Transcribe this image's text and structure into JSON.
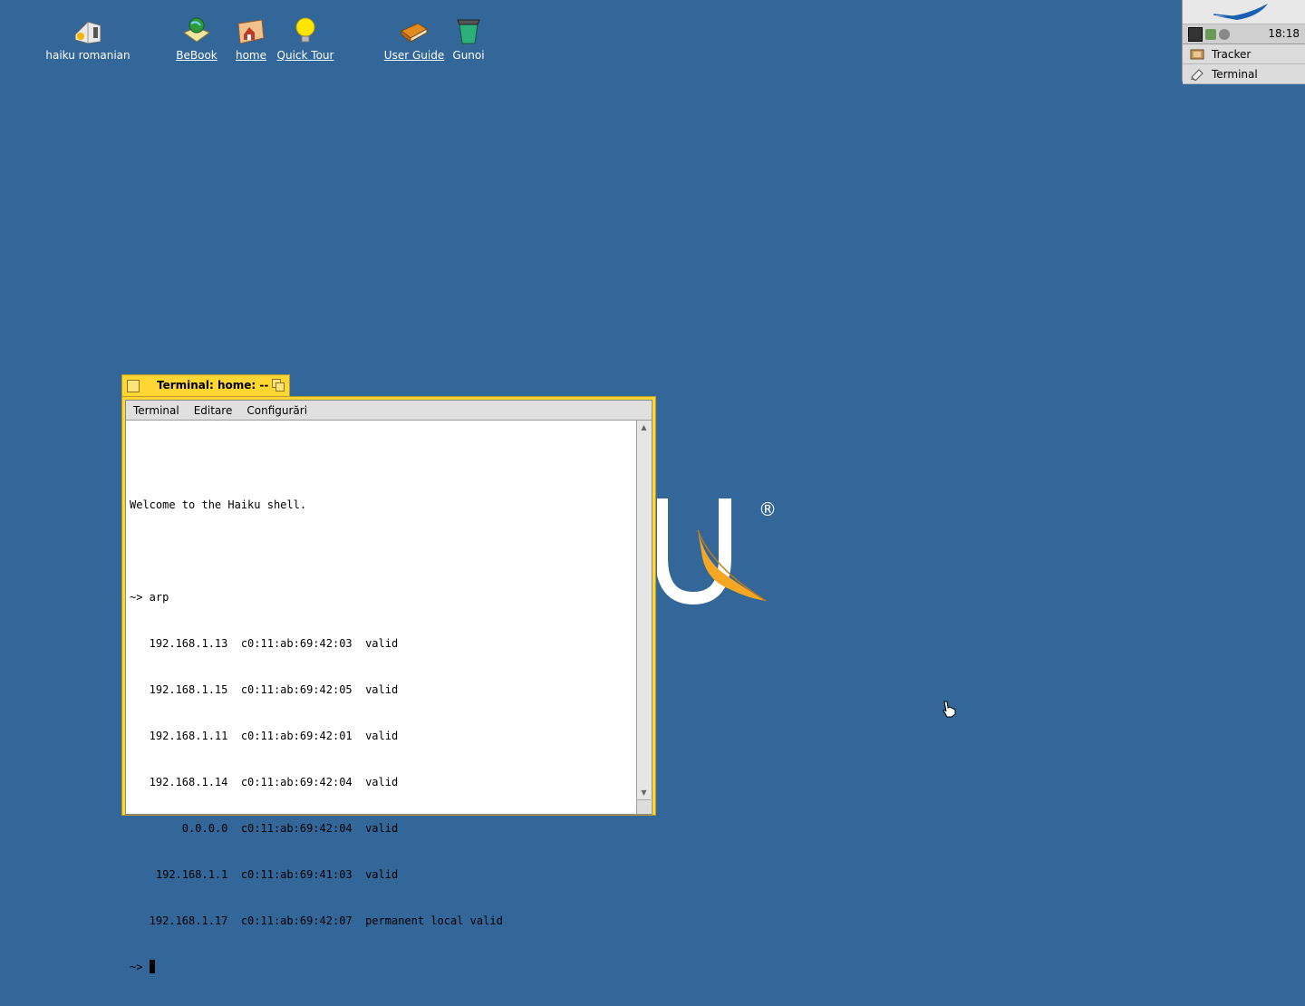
{
  "colors": {
    "desktop": "#336699",
    "window_tab": "#ffd633",
    "deskbar": "#d8d8d8"
  },
  "desktop_icons": [
    {
      "label": "haiku romanian",
      "icon": "volume-icon"
    },
    {
      "label": "BeBook",
      "icon": "bebook-icon"
    },
    {
      "label": "home",
      "icon": "home-folder-icon"
    },
    {
      "label": "Quick Tour",
      "icon": "lightbulb-icon"
    },
    {
      "label": "User Guide",
      "icon": "book-icon"
    },
    {
      "label": "Gunoi",
      "icon": "trash-icon"
    }
  ],
  "deskbar": {
    "clock": "18:18",
    "apps": [
      {
        "label": "Tracker",
        "icon": "tracker-icon"
      },
      {
        "label": "Terminal",
        "icon": "terminal-icon"
      }
    ]
  },
  "logo": {
    "letter": "U",
    "registered": "®"
  },
  "terminal_window": {
    "title": "Terminal: home: --",
    "menu": [
      "Terminal",
      "Editare",
      "Configurări"
    ],
    "lines": [
      "",
      "Welcome to the Haiku shell.",
      "",
      "~> arp",
      "   192.168.1.13  c0:11:ab:69:42:03  valid",
      "   192.168.1.15  c0:11:ab:69:42:05  valid",
      "   192.168.1.11  c0:11:ab:69:42:01  valid",
      "   192.168.1.14  c0:11:ab:69:42:04  valid",
      "        0.0.0.0  c0:11:ab:69:42:04  valid",
      "    192.168.1.1  c0:11:ab:69:41:03  valid",
      "   192.168.1.17  c0:11:ab:69:42:07  permanent local valid"
    ],
    "prompt": "~> "
  }
}
